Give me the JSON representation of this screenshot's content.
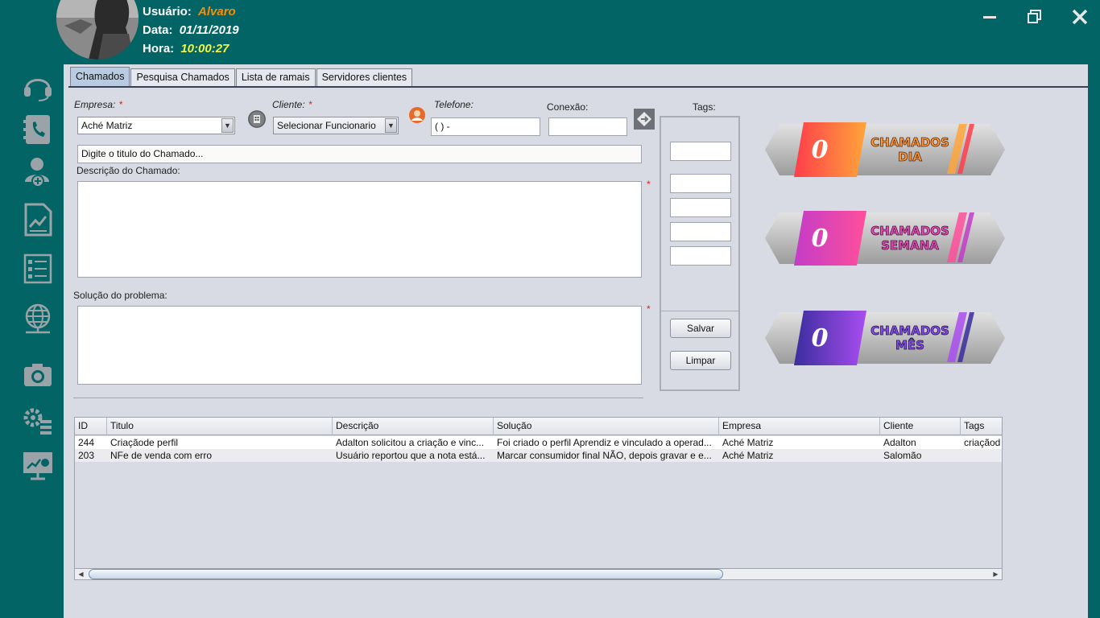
{
  "header": {
    "user_label": "Usuário:",
    "user_value": "Alvaro",
    "date_label": "Data:",
    "date_value": "01/11/2019",
    "time_label": "Hora:",
    "time_value": "10:00:27",
    "user_color": "#ff8c00",
    "time_color": "#f5f542"
  },
  "window_controls": [
    "minimize-icon",
    "maximize-icon",
    "close-icon"
  ],
  "sidebar": {
    "items": [
      {
        "icon": "headset-icon"
      },
      {
        "icon": "phone-book-icon"
      },
      {
        "icon": "add-user-icon"
      },
      {
        "icon": "report-chart-icon"
      },
      {
        "icon": "checklist-icon"
      },
      {
        "icon": "network-globe-icon"
      },
      {
        "icon": "camera-icon"
      },
      {
        "icon": "settings-list-icon"
      },
      {
        "icon": "dashboard-monitor-icon"
      }
    ]
  },
  "tabs": [
    "Chamados",
    "Pesquisa Chamados",
    "Lista de ramais",
    "Servidores clientes"
  ],
  "form": {
    "empresa_label": "Empresa:",
    "empresa_value": "Aché Matriz",
    "cliente_label": "Cliente:",
    "cliente_value": "Selecionar Funcionario",
    "telefone_label": "Telefone:",
    "telefone_value": "(  )     -",
    "conexao_label": "Conexão:",
    "conexao_value": "",
    "required_mark": "*",
    "titulo_value": "Digite o titulo do Chamado...",
    "descricao_label": "Descrição do Chamado:",
    "solucao_label": "Solução do problema:",
    "tags_label": "Tags:",
    "salvar_label": "Salvar",
    "limpar_label": "Limpar"
  },
  "counters": [
    {
      "value": "0",
      "line1": "CHAMADOS",
      "line2": "DIA",
      "color_a": "#ff3d4a",
      "color_b": "#ffa53a",
      "text_color": "#ff9a3a"
    },
    {
      "value": "0",
      "line1": "CHAMADOS",
      "line2": "SEMANA",
      "color_a": "#c43cc8",
      "color_b": "#ff4f9a",
      "text_color": "#e84cb8"
    },
    {
      "value": "0",
      "line1": "CHAMADOS",
      "line2": "MÊS",
      "color_a": "#3a2d9e",
      "color_b": "#a94df0",
      "text_color": "#8a4df0"
    }
  ],
  "table": {
    "columns": [
      "ID",
      "Titulo",
      "Descrição",
      "Solução",
      "Empresa",
      "Cliente",
      "Tags"
    ],
    "rows": [
      [
        "244",
        "Criaçãode perfil",
        "Adalton solicitou a criação e vinc...",
        "Foi criado o perfil Aprendiz e vinculado a operad...",
        "Aché Matriz",
        "Adalton",
        "criaçãod"
      ],
      [
        "203",
        "NFe de venda com erro",
        "Usuário reportou que a nota está...",
        "Marcar consumidor final NÃO, depois gravar e e...",
        "Aché Matriz",
        "Salomão",
        ""
      ]
    ]
  }
}
